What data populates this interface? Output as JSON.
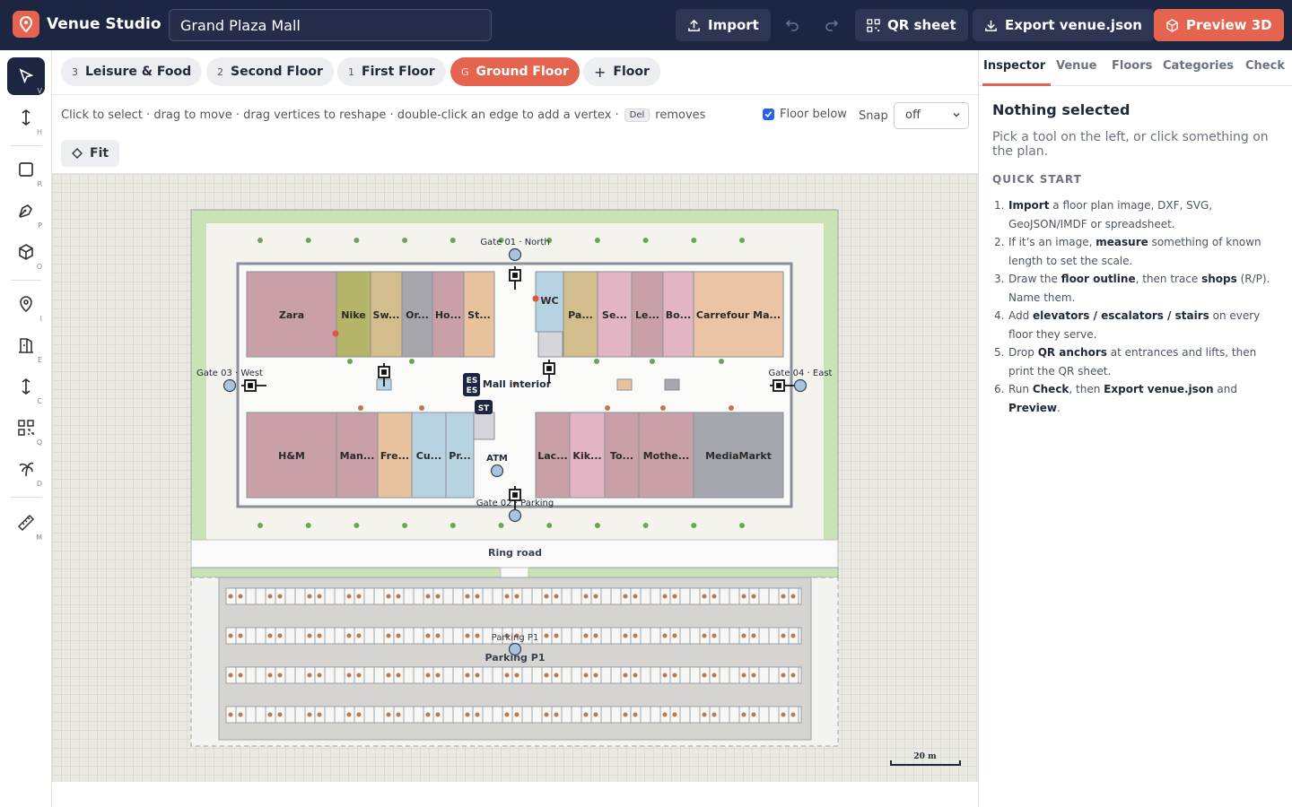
{
  "app": {
    "name": "Venue Studio",
    "venue_name": "Grand Plaza Mall",
    "accent": "#e5644f",
    "navy": "#1c2541"
  },
  "toolbar": {
    "import": "Import",
    "qr_sheet": "QR sheet",
    "export": "Export venue.json",
    "preview": "Preview 3D"
  },
  "tools": [
    {
      "icon": "select-icon",
      "key": "V"
    },
    {
      "icon": "height-icon",
      "key": "H"
    },
    {
      "icon": "rectangle-icon",
      "key": "R"
    },
    {
      "icon": "pen-icon",
      "key": "P"
    },
    {
      "icon": "cube-icon",
      "key": "O"
    },
    {
      "icon": "pin-icon",
      "key": "I"
    },
    {
      "icon": "elevator-icon",
      "key": "E"
    },
    {
      "icon": "connector-icon",
      "key": "C"
    },
    {
      "icon": "qr-icon",
      "key": "Q"
    },
    {
      "icon": "palm-icon",
      "key": "D"
    },
    {
      "icon": "ruler-icon",
      "key": "M"
    }
  ],
  "floors": [
    {
      "level": "3",
      "name": "Leisure & Food"
    },
    {
      "level": "2",
      "name": "Second Floor"
    },
    {
      "level": "1",
      "name": "First Floor"
    },
    {
      "level": "G",
      "name": "Ground Floor",
      "active": true
    }
  ],
  "add_floor": "Floor",
  "hint": {
    "text": "Click to select · drag to move · drag vertices to reshape · double-click an edge to add a vertex ·",
    "key": "Del",
    "suffix": "removes"
  },
  "floor_below": "Floor below",
  "snap_label": "Snap",
  "snap_value": "off",
  "fit": "Fit",
  "inspector": {
    "tabs": [
      "Inspector",
      "Venue",
      "Floors",
      "Categories",
      "Check"
    ],
    "title": "Nothing selected",
    "desc": "Pick a tool on the left, or click something on the plan.",
    "quick_start": "QUICK START",
    "steps": [
      [
        "",
        "Import",
        " a floor plan image, DXF, SVG, GeoJSON/IMDF or spreadsheet."
      ],
      [
        "If it’s an image, ",
        "measure",
        " something of known length to set the scale."
      ],
      [
        "Draw the ",
        "floor outline",
        ", then trace "
      ],
      [
        "Add ",
        "elevators / escalators / stairs",
        " on every floor they serve."
      ],
      [
        "Drop ",
        "QR anchors",
        " at entrances and lifts, then print the QR sheet."
      ],
      [
        "Run ",
        "Check",
        ", then "
      ]
    ],
    "step3_extra": {
      "bold": "shops",
      "rest": " (R/P). Name them."
    },
    "step6_extra": {
      "bold1": "Export venue.json",
      "mid": " and ",
      "bold2": "Preview",
      "end": "."
    }
  },
  "plan": {
    "shops_top_left": [
      {
        "name": "Zara",
        "color": "#c9a0a8"
      },
      {
        "name": "Nike",
        "color": "#b5b56a"
      },
      {
        "name": "Sw...",
        "color": "#d3bd8c"
      },
      {
        "name": "Or...",
        "color": "#a6a6ad"
      },
      {
        "name": "Ho...",
        "color": "#c9a0a8"
      },
      {
        "name": "St...",
        "color": "#e8c29c"
      }
    ],
    "shops_top_right": [
      {
        "name": "WC",
        "color": "#b7d2e0"
      },
      {
        "name": "Pa...",
        "color": "#d3bd8c"
      },
      {
        "name": "Se...",
        "color": "#e2b4c4"
      },
      {
        "name": "Le...",
        "color": "#c9a0a8"
      },
      {
        "name": "Bo...",
        "color": "#e2b4c4"
      },
      {
        "name": "Carrefour Ma...",
        "color": "#eac4a4"
      }
    ],
    "shops_bottom_left": [
      {
        "name": "H&M",
        "color": "#c9a0a8"
      },
      {
        "name": "Man...",
        "color": "#c9a0a8"
      },
      {
        "name": "Fre...",
        "color": "#e8c29c"
      },
      {
        "name": "Cu...",
        "color": "#b7d2e0"
      },
      {
        "name": "Pr...",
        "color": "#b7d2e0"
      }
    ],
    "shops_bottom_right": [
      {
        "name": "Lac...",
        "color": "#c9a0a8"
      },
      {
        "name": "Kik...",
        "color": "#e2b4c4"
      },
      {
        "name": "To...",
        "color": "#c9a0a8"
      },
      {
        "name": "Mothe...",
        "color": "#c9a0a8"
      },
      {
        "name": "MediaMarkt",
        "color": "#a6a6ad"
      }
    ],
    "gates": {
      "north": "Gate 01 · North",
      "west": "Gate 03 · West",
      "east": "Gate 04 · East",
      "south": "Gate 02 · Parking"
    },
    "mall_interior": "Mall interior",
    "atm": "ATM",
    "es": "ES",
    "st": "ST",
    "ring_road": "Ring road",
    "parking": "Parking P1",
    "parking_anchor": "Parking P1",
    "scale": "20 m"
  }
}
